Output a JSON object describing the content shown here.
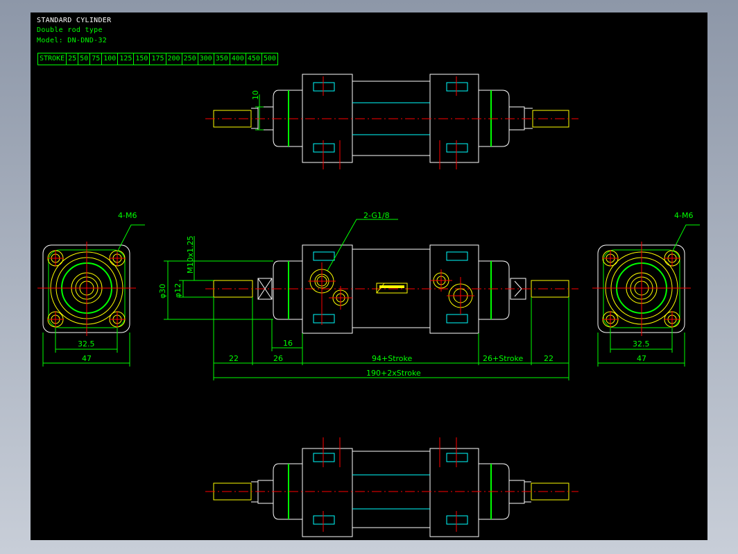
{
  "header": {
    "title": "STANDARD CYLINDER",
    "type": "Double rod type",
    "model": "Model: DN-DND-32"
  },
  "stroke_table": [
    "STROKE",
    "25",
    "50",
    "75",
    "100",
    "125",
    "150",
    "175",
    "200",
    "250",
    "300",
    "350",
    "400",
    "450",
    "500"
  ],
  "dims": {
    "top_rod_width": "10",
    "port_label": "2-G1/8",
    "left_thread_label": "4-M6",
    "right_thread_label": "4-M6",
    "thread_spec": "M10x1.25",
    "bore_dia": "φ30",
    "rod_dia": "φ12",
    "bolt_pitch_left": "32.5",
    "body_width_left": "47",
    "bolt_pitch_right": "32.5",
    "body_width_right": "47",
    "rod_ext_left": "22",
    "cap_len_left": "26",
    "boss_len": "16",
    "body_len": "94+Stroke",
    "cap_len_right": "26+Stroke",
    "rod_ext_right": "22",
    "total_len": "190+2xStroke"
  },
  "colors": {
    "background": "#000000",
    "outline": "#ffffff",
    "yellow": "#ffff00",
    "green": "#00ff00",
    "cyan": "#00ffff",
    "red": "#ff0000",
    "bright_green": "#33ff33"
  }
}
